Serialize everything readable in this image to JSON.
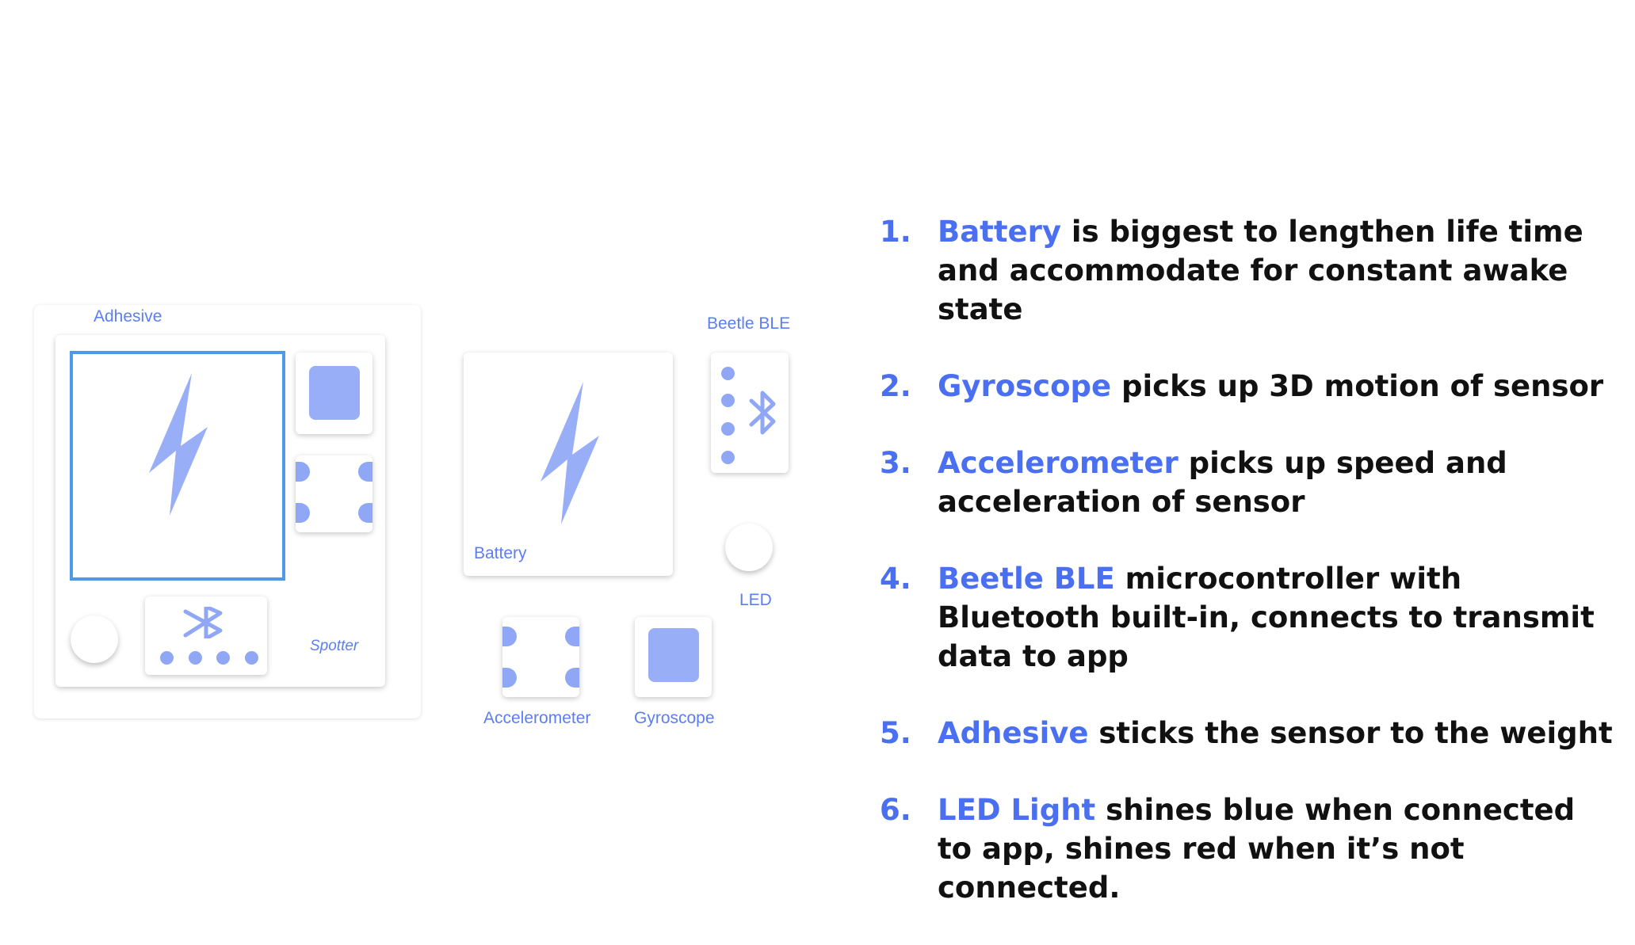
{
  "colors": {
    "accent": "#4a6ff0",
    "component_fill": "#98aef7",
    "battery_outline": "#4f9ae8"
  },
  "diagram": {
    "assembled": {
      "adhesive_label": "Adhesive",
      "spotter_label": "Spotter",
      "battery_icon": "lightning-bolt-icon",
      "bluetooth_icon": "bluetooth-icon"
    },
    "exploded": {
      "battery_label": "Battery",
      "beetle_label": "Beetle BLE",
      "led_label": "LED",
      "accelerometer_label": "Accelerometer",
      "gyroscope_label": "Gyroscope"
    }
  },
  "list": [
    {
      "num": "1.",
      "key": "Battery",
      "rest": " is biggest to lengthen life time and accommodate for constant awake state"
    },
    {
      "num": "2.",
      "key": "Gyroscope",
      "rest": " picks up 3D motion of sensor"
    },
    {
      "num": "3.",
      "key": "Accelerometer",
      "rest": " picks up speed and acceleration of sensor"
    },
    {
      "num": "4.",
      "key": "Beetle BLE",
      "rest": " microcontroller with Bluetooth built-in, connects to transmit data to app"
    },
    {
      "num": "5.",
      "key": "Adhesive",
      "rest": " sticks the sensor to the weight"
    },
    {
      "num": "6.",
      "key": "LED Light",
      "rest": " shines blue when connected to app, shines red when it’s not connected."
    }
  ]
}
